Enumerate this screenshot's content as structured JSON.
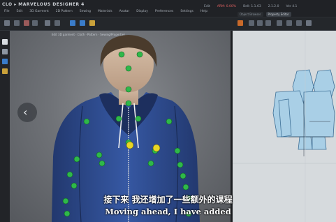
{
  "app": {
    "logo_text": "CLO ▸ MARVELOUS DESIGNER 4",
    "menu": [
      "File",
      "Edit",
      "3D Garment",
      "2D Pattern",
      "Sewing",
      "Materials",
      "Avatar",
      "Display",
      "Preferences",
      "Settings",
      "Help"
    ]
  },
  "status": {
    "items": [
      "Edit",
      "ARM: 0.00%",
      "Bell: 1.1.63",
      "2.1.2.0",
      "Ver 4.1"
    ],
    "warn_index": 1
  },
  "panel_tabs": [
    "Object Browser",
    "Property Editor"
  ],
  "viewport3d": {
    "title": "Edit 3D garment · Cloth · Pattern · Sewing/Properties"
  },
  "subtitles": {
    "zh": "接下来 我还增加了一些额外的课程",
    "en": "Moving ahead, I have added"
  },
  "colors": {
    "hoodie": "#2e4b8f",
    "point_green": "#2fb84a",
    "point_yellow": "#e8d624",
    "pattern_fill": "#a9cfe6",
    "accent_red": "#e06262"
  }
}
